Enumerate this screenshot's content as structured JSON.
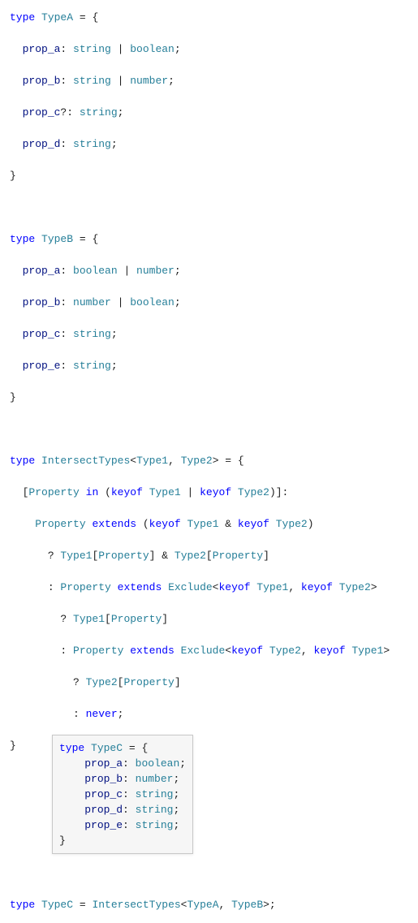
{
  "code": {
    "l1": {
      "kw": "type",
      "name": "TypeA",
      "eq": " = {"
    },
    "l2": {
      "prop": "prop_a",
      "col": ": ",
      "t1": "string",
      "or": " | ",
      "t2": "boolean",
      "semi": ";"
    },
    "l3": {
      "prop": "prop_b",
      "col": ": ",
      "t1": "string",
      "or": " | ",
      "t2": "number",
      "semi": ";"
    },
    "l4": {
      "prop": "prop_c",
      "opt": "?",
      "col": ": ",
      "t1": "string",
      "semi": ";"
    },
    "l5": {
      "prop": "prop_d",
      "col": ": ",
      "t1": "string",
      "semi": ";"
    },
    "l6": {
      "close": "}"
    },
    "l7": {
      "blank": ""
    },
    "l8": {
      "kw": "type",
      "name": "TypeB",
      "eq": " = {"
    },
    "l9": {
      "prop": "prop_a",
      "col": ": ",
      "t1": "boolean",
      "or": " | ",
      "t2": "number",
      "semi": ";"
    },
    "l10": {
      "prop": "prop_b",
      "col": ": ",
      "t1": "number",
      "or": " | ",
      "t2": "boolean",
      "semi": ";"
    },
    "l11": {
      "prop": "prop_c",
      "col": ": ",
      "t1": "string",
      "semi": ";"
    },
    "l12": {
      "prop": "prop_e",
      "col": ": ",
      "t1": "string",
      "semi": ";"
    },
    "l13": {
      "close": "}"
    },
    "l14": {
      "blank": ""
    },
    "l15": {
      "kw": "type",
      "name": "IntersectTypes",
      "lt": "<",
      "g1": "Type1",
      "comma": ", ",
      "g2": "Type2",
      "gt": "> = {"
    },
    "l16": {
      "open": "[",
      "prop": "Property",
      "in": " in ",
      "paren": "(",
      "keyof1": "keyof ",
      "t1": "Type1",
      "or": " | ",
      "keyof2": "keyof ",
      "t2": "Type2",
      "close": ")]:"
    },
    "l17": {
      "prop": "Property",
      "ext": " extends ",
      "paren": "(",
      "keyof1": "keyof ",
      "t1": "Type1",
      "amp": " & ",
      "keyof2": "keyof ",
      "t2": "Type2",
      "close": ")"
    },
    "l18": {
      "q": "? ",
      "t1": "Type1",
      "br1": "[",
      "prop": "Property",
      "br2": "] & ",
      "t2": "Type2",
      "br3": "[",
      "prop2": "Property",
      "br4": "]"
    },
    "l19": {
      "c": ": ",
      "prop": "Property",
      "ext": " extends ",
      "excl": "Exclude",
      "lt": "<",
      "keyof1": "keyof ",
      "t1": "Type1",
      "comma": ", ",
      "keyof2": "keyof ",
      "t2": "Type2",
      "gt": ">"
    },
    "l20": {
      "q": "? ",
      "t1": "Type1",
      "br1": "[",
      "prop": "Property",
      "br2": "]"
    },
    "l21": {
      "c": ": ",
      "prop": "Property",
      "ext": " extends ",
      "excl": "Exclude",
      "lt": "<",
      "keyof1": "keyof ",
      "t1": "Type2",
      "comma": ", ",
      "keyof2": "keyof ",
      "t2": "Type1",
      "gt": ">"
    },
    "l22": {
      "q": "? ",
      "t1": "Type2",
      "br1": "[",
      "prop": "Property",
      "br2": "]"
    },
    "l23": {
      "c": ": ",
      "never": "never",
      "semi": ";"
    },
    "l24": {
      "close": "}"
    },
    "l25": {
      "blank": ""
    },
    "l26": {
      "kw": "type",
      "name": "TypeC",
      "eq": " = ",
      "fn": "IntersectTypes",
      "lt": "<",
      "t1": "TypeA",
      "comma": ", ",
      "t2": "TypeB",
      "gt": ">;"
    }
  },
  "tooltip": {
    "l1": {
      "kw": "type",
      "name": "TypeC",
      "eq": " = {"
    },
    "l2": {
      "prop": "prop_a",
      "col": ": ",
      "t": "boolean",
      "semi": ";"
    },
    "l3": {
      "prop": "prop_b",
      "col": ": ",
      "t": "number",
      "semi": ";"
    },
    "l4": {
      "prop": "prop_c",
      "col": ": ",
      "t": "string",
      "semi": ";"
    },
    "l5": {
      "prop": "prop_d",
      "col": ": ",
      "t": "string",
      "semi": ";"
    },
    "l6": {
      "prop": "prop_e",
      "col": ": ",
      "t": "string",
      "semi": ";"
    },
    "l7": {
      "close": "}"
    }
  }
}
